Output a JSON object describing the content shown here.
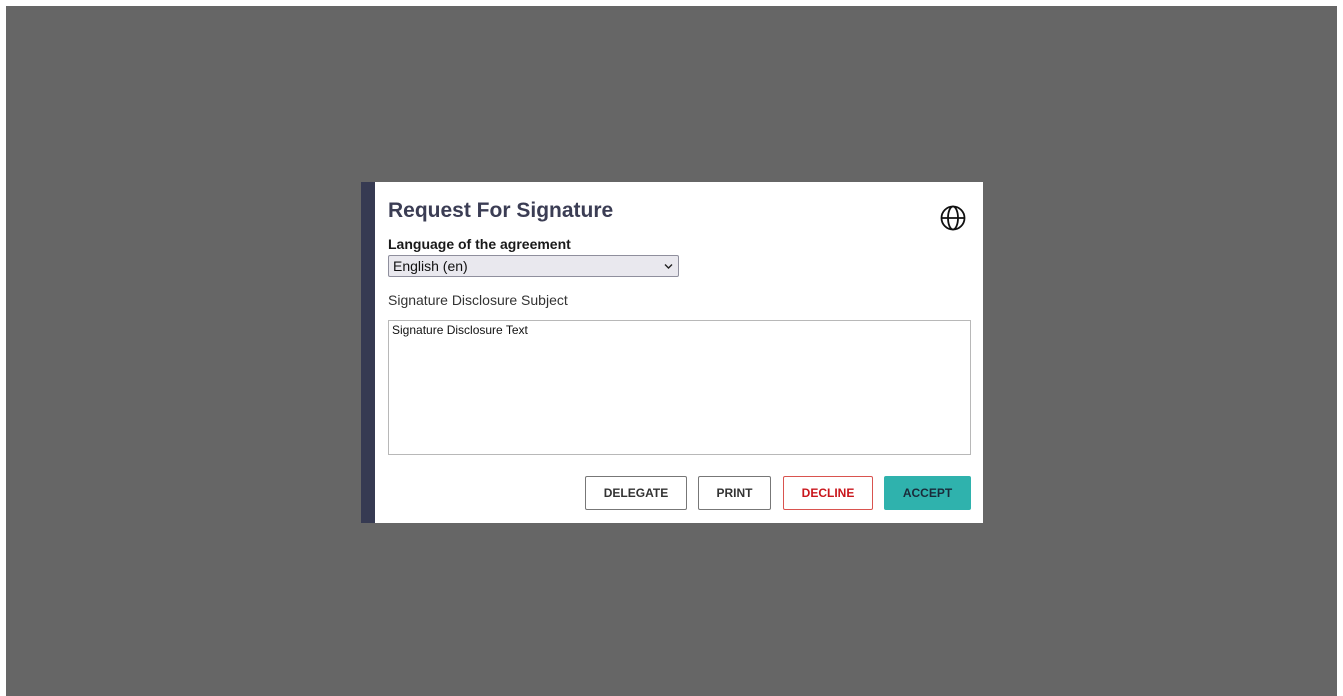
{
  "dialog": {
    "title": "Request For Signature",
    "language_label": "Language of the agreement",
    "language_selected": "English (en)",
    "subject": "Signature Disclosure Subject",
    "disclosure_text": "Signature Disclosure Text"
  },
  "buttons": {
    "delegate": "DELEGATE",
    "print": "PRINT",
    "decline": "DECLINE",
    "accept": "ACCEPT"
  },
  "colors": {
    "overlay": "#666666",
    "accent_bar": "#363a52",
    "accept": "#2fb2ad",
    "decline": "#c9161c"
  },
  "icons": {
    "language": "globe-icon",
    "select": "chevron-down-icon"
  }
}
